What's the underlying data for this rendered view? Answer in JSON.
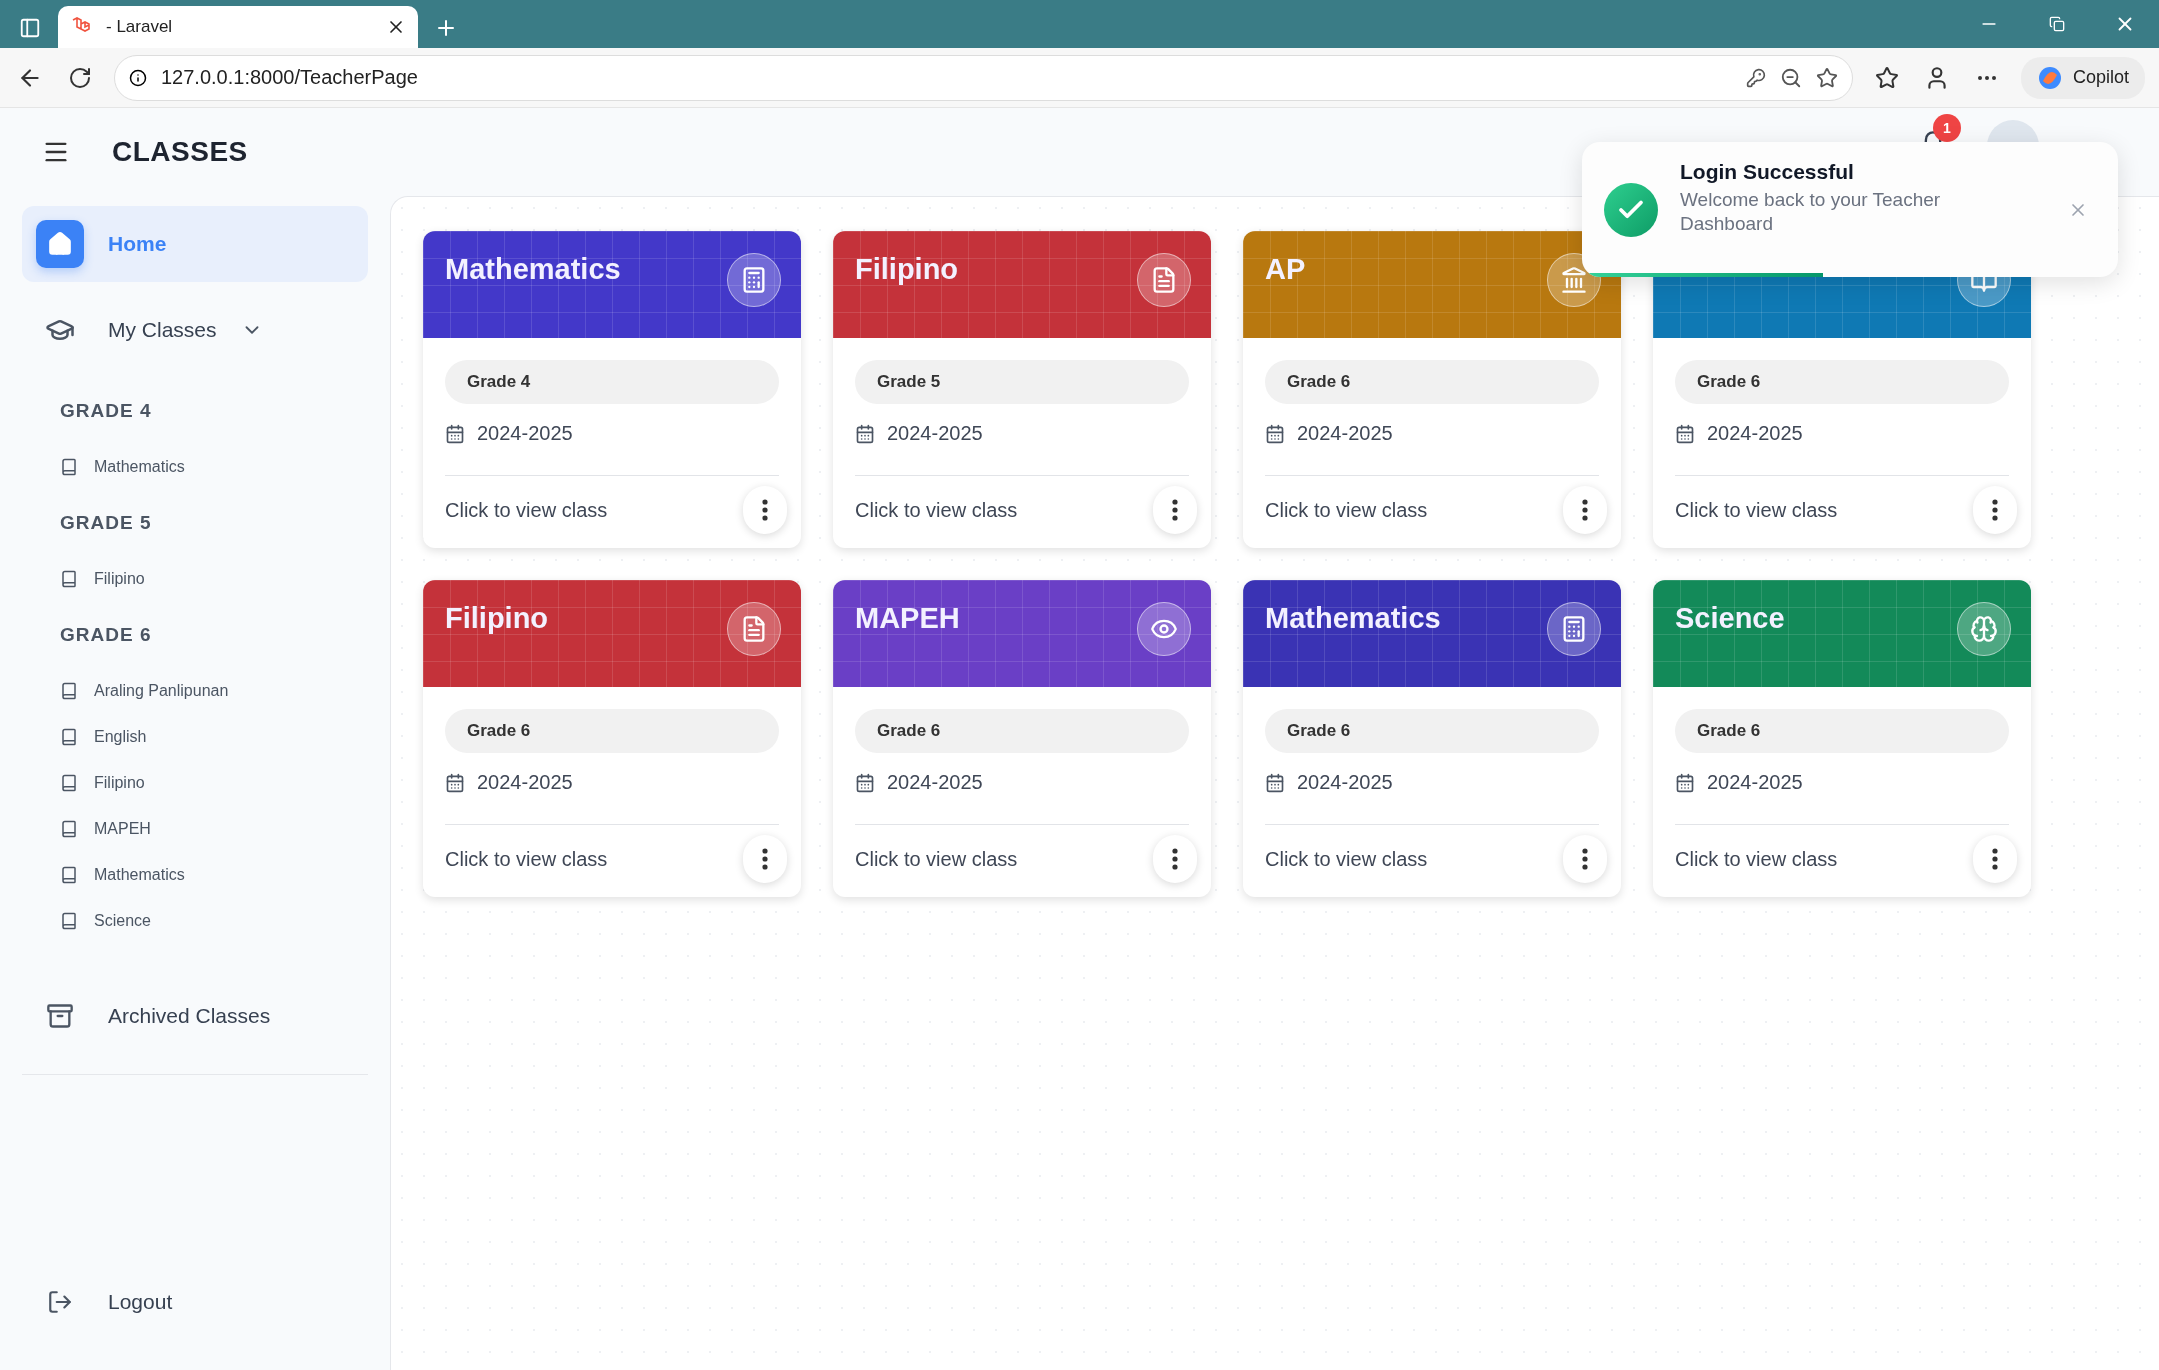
{
  "browser": {
    "tab_title": "- Laravel",
    "url": "127.0.0.1:8000/TeacherPage",
    "copilot_label": "Copilot"
  },
  "header": {
    "title": "CLASSES",
    "notification_count": "1"
  },
  "sidebar": {
    "items": [
      {
        "label": "Home",
        "kind": "home",
        "selected": true
      },
      {
        "label": "My Classes",
        "kind": "classes",
        "selected": false,
        "expanded": true,
        "children": [
          {
            "label": "GRADE 4",
            "children": [
              {
                "label": "Mathematics",
                "selected": false
              }
            ]
          },
          {
            "label": "GRADE 5",
            "children": [
              {
                "label": "Filipino",
                "selected": false
              }
            ]
          },
          {
            "label": "GRADE 6",
            "children": [
              {
                "label": "Araling Panlipunan",
                "selected": false
              },
              {
                "label": "English",
                "selected": false
              },
              {
                "label": "Filipino",
                "selected": false
              },
              {
                "label": "MAPEH",
                "selected": false
              },
              {
                "label": "Mathematics",
                "selected": false
              },
              {
                "label": "Science",
                "selected": false
              }
            ]
          }
        ]
      },
      {
        "label": "Archived Classes",
        "kind": "archive",
        "selected": false
      }
    ],
    "logout": "Logout"
  },
  "cards": [
    {
      "title": "Mathematics",
      "kind": "math",
      "color": "#4338c9",
      "grade": "Grade 4",
      "year": "2024-2025",
      "action": "Click to view class"
    },
    {
      "title": "Filipino",
      "kind": "language",
      "color": "#c4323a",
      "grade": "Grade 5",
      "year": "2024-2025",
      "action": "Click to view class"
    },
    {
      "title": "AP",
      "kind": "history",
      "color": "#b8780f",
      "grade": "Grade 6",
      "year": "2024-2025",
      "action": "Click to view class"
    },
    {
      "kind": "reading",
      "color": "#0f79b4",
      "grade": "Grade 6",
      "year": "2024-2025",
      "action": "Click to view class"
    },
    {
      "title": "Filipino",
      "kind": "language",
      "color": "#c4323a",
      "grade": "Grade 6",
      "year": "2024-2025",
      "action": "Click to view class"
    },
    {
      "title": "MAPEH",
      "kind": "arts",
      "color": "#6a3fc6",
      "grade": "Grade 6",
      "year": "2024-2025",
      "action": "Click to view class"
    },
    {
      "title": "Mathematics",
      "kind": "math",
      "color": "#3a33b4",
      "grade": "Grade 6",
      "year": "2024-2025",
      "action": "Click to view class"
    },
    {
      "title": "Science",
      "kind": "science",
      "color": "#138a59",
      "grade": "Grade 6",
      "year": "2024-2025",
      "action": "Click to view class"
    }
  ],
  "toast": {
    "title": "Login Successful",
    "message": "Welcome back to your Teacher Dashboard",
    "level": 0.45
  }
}
